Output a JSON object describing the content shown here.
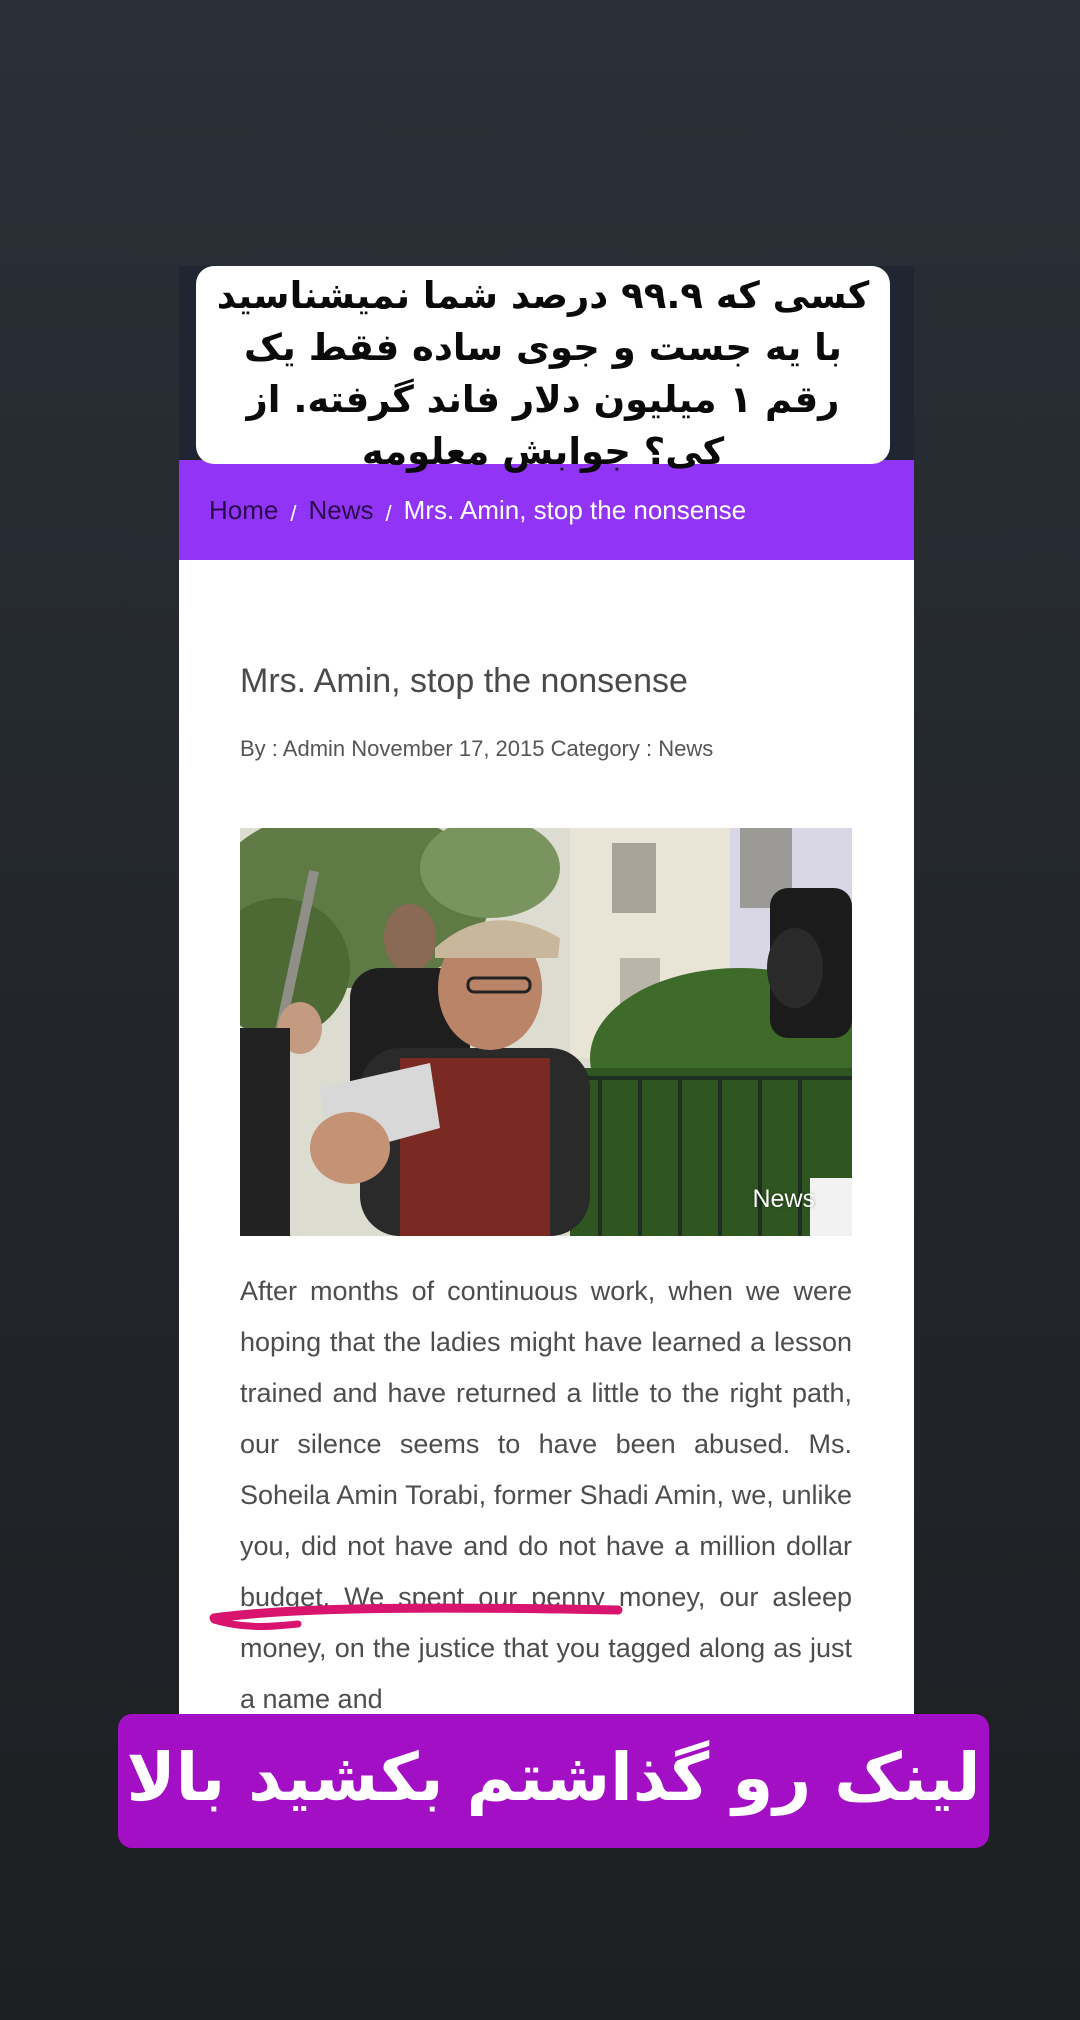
{
  "top_caption": {
    "text": "کسی که ۹۹.۹ درصد شما نمیشناسید با یه جست و جوی ساده فقط یک رقم ۱ میلیون دلار فاند گرفته. از کی؟ جوابش معلومه"
  },
  "breadcrumb": {
    "home": "Home",
    "separator": "/",
    "news": "News",
    "current": "Mrs. Amin, stop the nonsense"
  },
  "article": {
    "title": "Mrs. Amin, stop the nonsense",
    "meta": "By : Admin November 17, 2015 Category : News",
    "image_badge": "News",
    "body": "After months of continuous work, when we were hoping that the ladies might have learned a lesson trained and have returned a little to the right path, our silence seems to have been abused. Ms. Soheila Amin Torabi, former Shadi Amin, we, unlike you, did not have and do not have a million dollar budget. We spent our penny money, our asleep money, on the justice that you tagged along as just a name and"
  },
  "bottom_caption": {
    "text": "لینک رو گذاشتم بکشید بالا"
  },
  "colors": {
    "breadcrumb_bg": "#9234f5",
    "underline": "#d8146f",
    "bottom_sticker": "#a30fc4"
  }
}
